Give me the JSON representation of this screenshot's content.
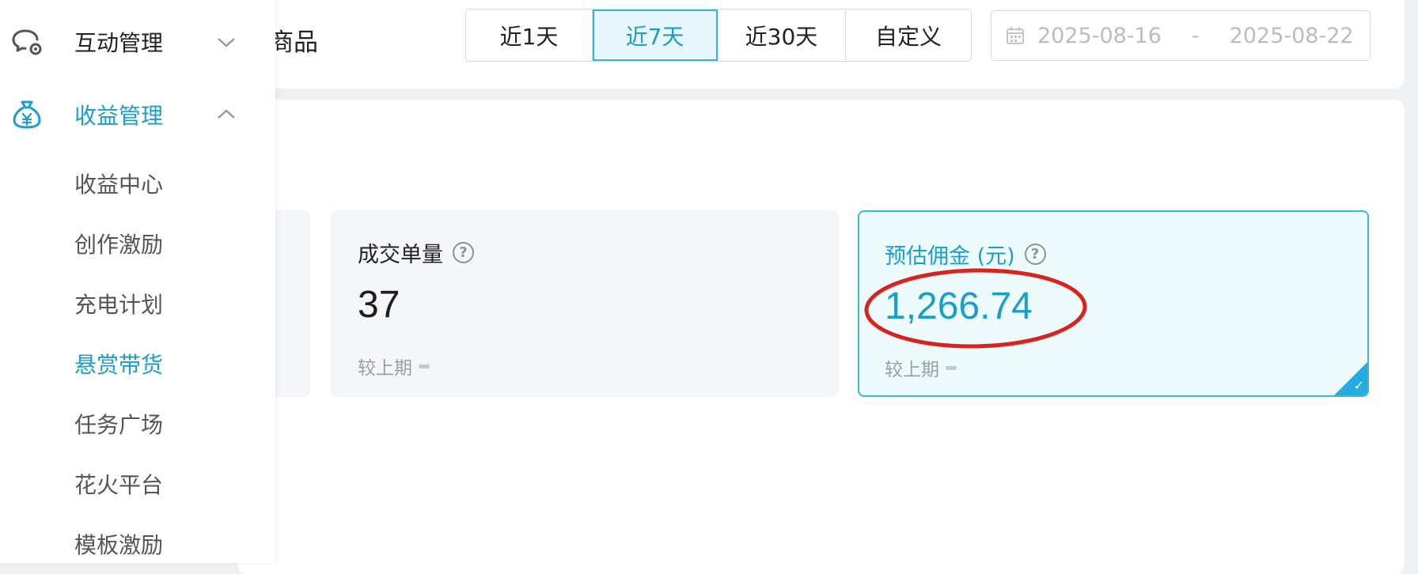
{
  "header": {
    "title_fragment": "商品",
    "ranges": [
      {
        "label": "近1天"
      },
      {
        "label": "近7天"
      },
      {
        "label": "近30天"
      },
      {
        "label": "自定义"
      }
    ],
    "active_range": "近7天",
    "date_start": "2025-08-16",
    "date_separator": "-",
    "date_end": "2025-08-22"
  },
  "sidebar": {
    "groups": [
      {
        "label": "互动管理",
        "icon": "chat-gear-icon",
        "expanded": false
      },
      {
        "label": "收益管理",
        "icon": "money-bag-icon",
        "expanded": true
      }
    ],
    "sub_items": [
      {
        "label": "收益中心"
      },
      {
        "label": "创作激励"
      },
      {
        "label": "充电计划"
      },
      {
        "label": "悬赏带货",
        "active": true
      },
      {
        "label": "任务广场"
      },
      {
        "label": "花火平台"
      },
      {
        "label": "模板激励"
      }
    ]
  },
  "metrics": [
    {
      "label": "成交单量",
      "help_icon": "question-circle-icon",
      "value": "37",
      "compare_label": "较上期",
      "selected": false
    },
    {
      "label": "预估佣金 (元)",
      "help_icon": "question-circle-icon",
      "value": "1,266.74",
      "compare_label": "较上期",
      "selected": true
    }
  ],
  "colors": {
    "accent": "#1a9fca",
    "accent_border": "#3ab8dd",
    "selected_bg": "#eefbfd",
    "annotation": "#d9231e"
  }
}
